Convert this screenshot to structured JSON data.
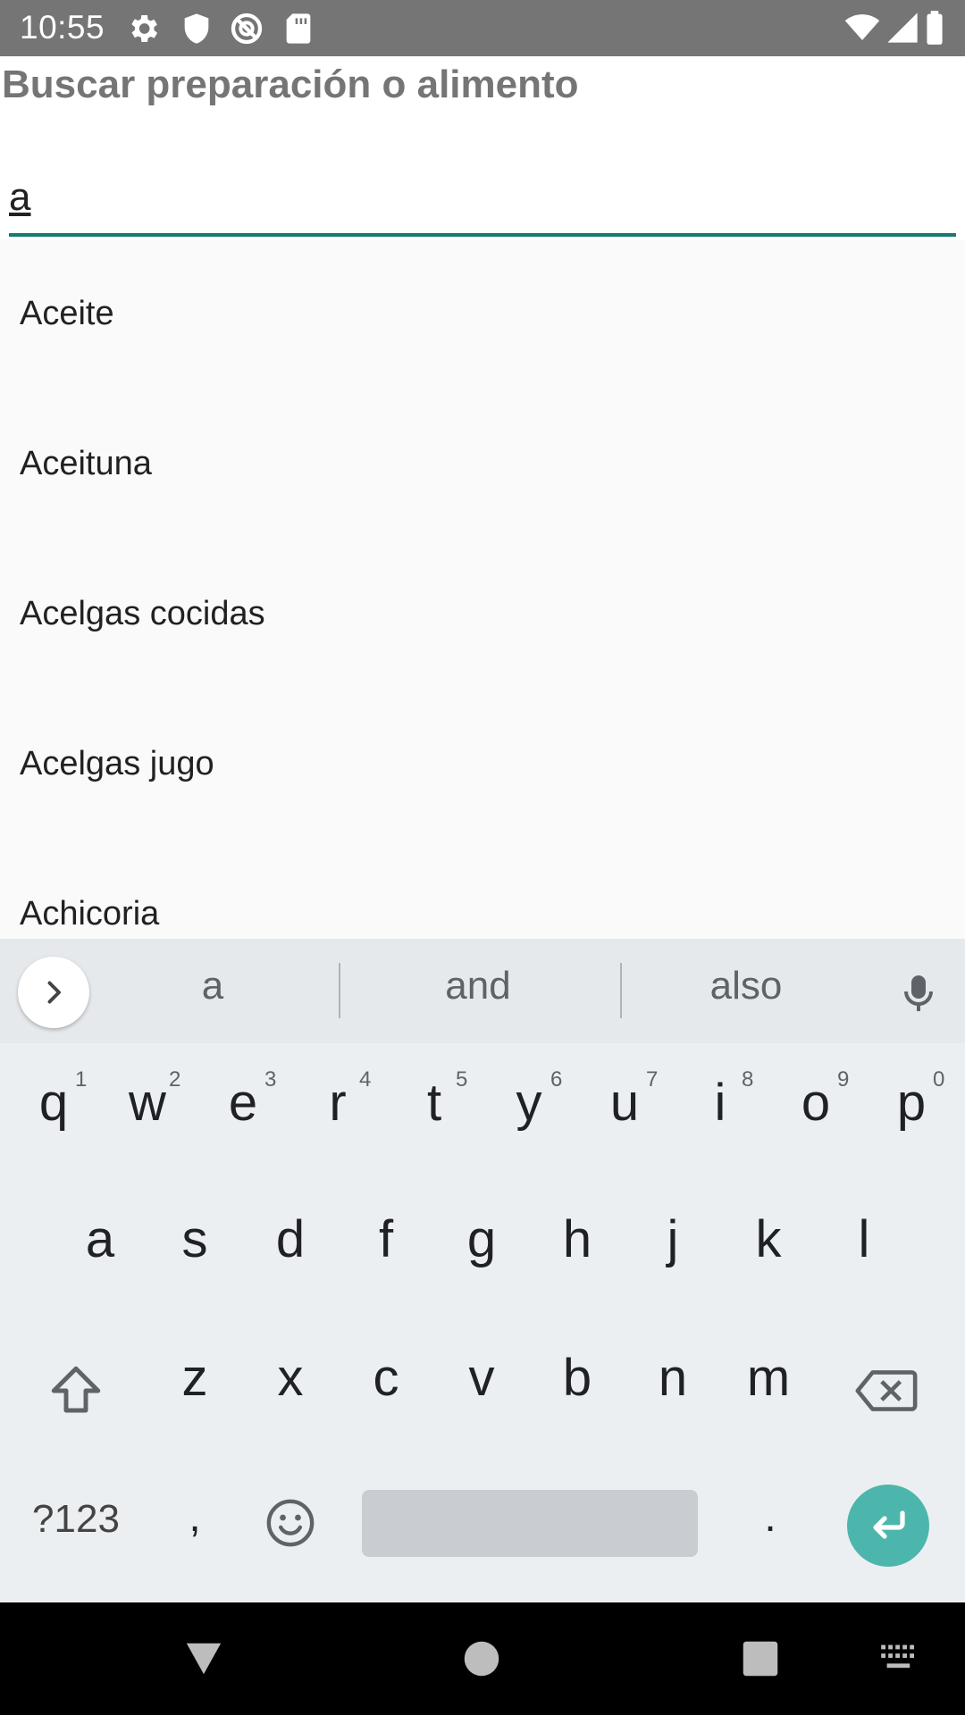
{
  "status_bar": {
    "time": "10:55",
    "left_icons": [
      "gear-icon",
      "shield-icon",
      "no-data-saver-icon",
      "sd-card-icon"
    ],
    "right_icons": [
      "wifi-icon",
      "cell-signal-icon",
      "battery-icon"
    ]
  },
  "header": {
    "title": "Buscar preparación o alimento"
  },
  "search": {
    "value": "a",
    "placeholder": ""
  },
  "results": [
    {
      "label": "Aceite"
    },
    {
      "label": "Aceituna"
    },
    {
      "label": "Acelgas cocidas"
    },
    {
      "label": "Acelgas jugo"
    },
    {
      "label": "Achicoria"
    }
  ],
  "keyboard": {
    "suggestions": [
      "a",
      "and",
      "also"
    ],
    "row1": [
      {
        "ch": "q",
        "num": "1"
      },
      {
        "ch": "w",
        "num": "2"
      },
      {
        "ch": "e",
        "num": "3"
      },
      {
        "ch": "r",
        "num": "4"
      },
      {
        "ch": "t",
        "num": "5"
      },
      {
        "ch": "y",
        "num": "6"
      },
      {
        "ch": "u",
        "num": "7"
      },
      {
        "ch": "i",
        "num": "8"
      },
      {
        "ch": "o",
        "num": "9"
      },
      {
        "ch": "p",
        "num": "0"
      }
    ],
    "row2": [
      "a",
      "s",
      "d",
      "f",
      "g",
      "h",
      "j",
      "k",
      "l"
    ],
    "row3": [
      "z",
      "x",
      "c",
      "v",
      "b",
      "n",
      "m"
    ],
    "symbols_label": "?123",
    "comma": ",",
    "period": ".",
    "accent_color": "#4db6ac"
  },
  "colors": {
    "status_bar": "#757575",
    "input_underline": "#167a70",
    "header_text": "#757575"
  },
  "nav_bar": {
    "icons": [
      "back-icon",
      "home-icon",
      "recents-icon",
      "keyboard-switch-icon"
    ]
  }
}
